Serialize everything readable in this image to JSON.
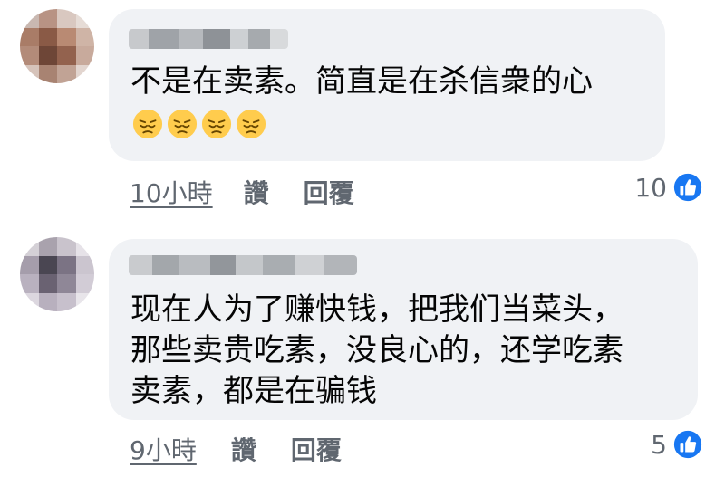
{
  "colors": {
    "bubble": "#f0f2f5",
    "text": "#050505",
    "meta": "#606770",
    "like_blue": "#1877f2",
    "emoji_yellow": "#ffcc4d"
  },
  "comments": [
    {
      "author_name": "",
      "text_lines": [
        "不是在卖素。简直是在杀信衆的心"
      ],
      "emoji": [
        "pensive-face-emoji",
        "pensive-face-emoji",
        "pensive-face-emoji",
        "pensive-face-emoji"
      ],
      "time": "10小時",
      "like_label": "讚",
      "reply_label": "回覆",
      "reaction_count": "10",
      "reaction_icon": "like-icon"
    },
    {
      "author_name": "",
      "text_lines": [
        "现在人为了赚快钱，把我们当菜头，",
        "那些卖贵吃素，没良心的，还学吃素",
        "卖素，都是在骗钱"
      ],
      "emoji": [],
      "time": "9小時",
      "like_label": "讚",
      "reply_label": "回覆",
      "reaction_count": "5",
      "reaction_icon": "like-icon"
    }
  ]
}
